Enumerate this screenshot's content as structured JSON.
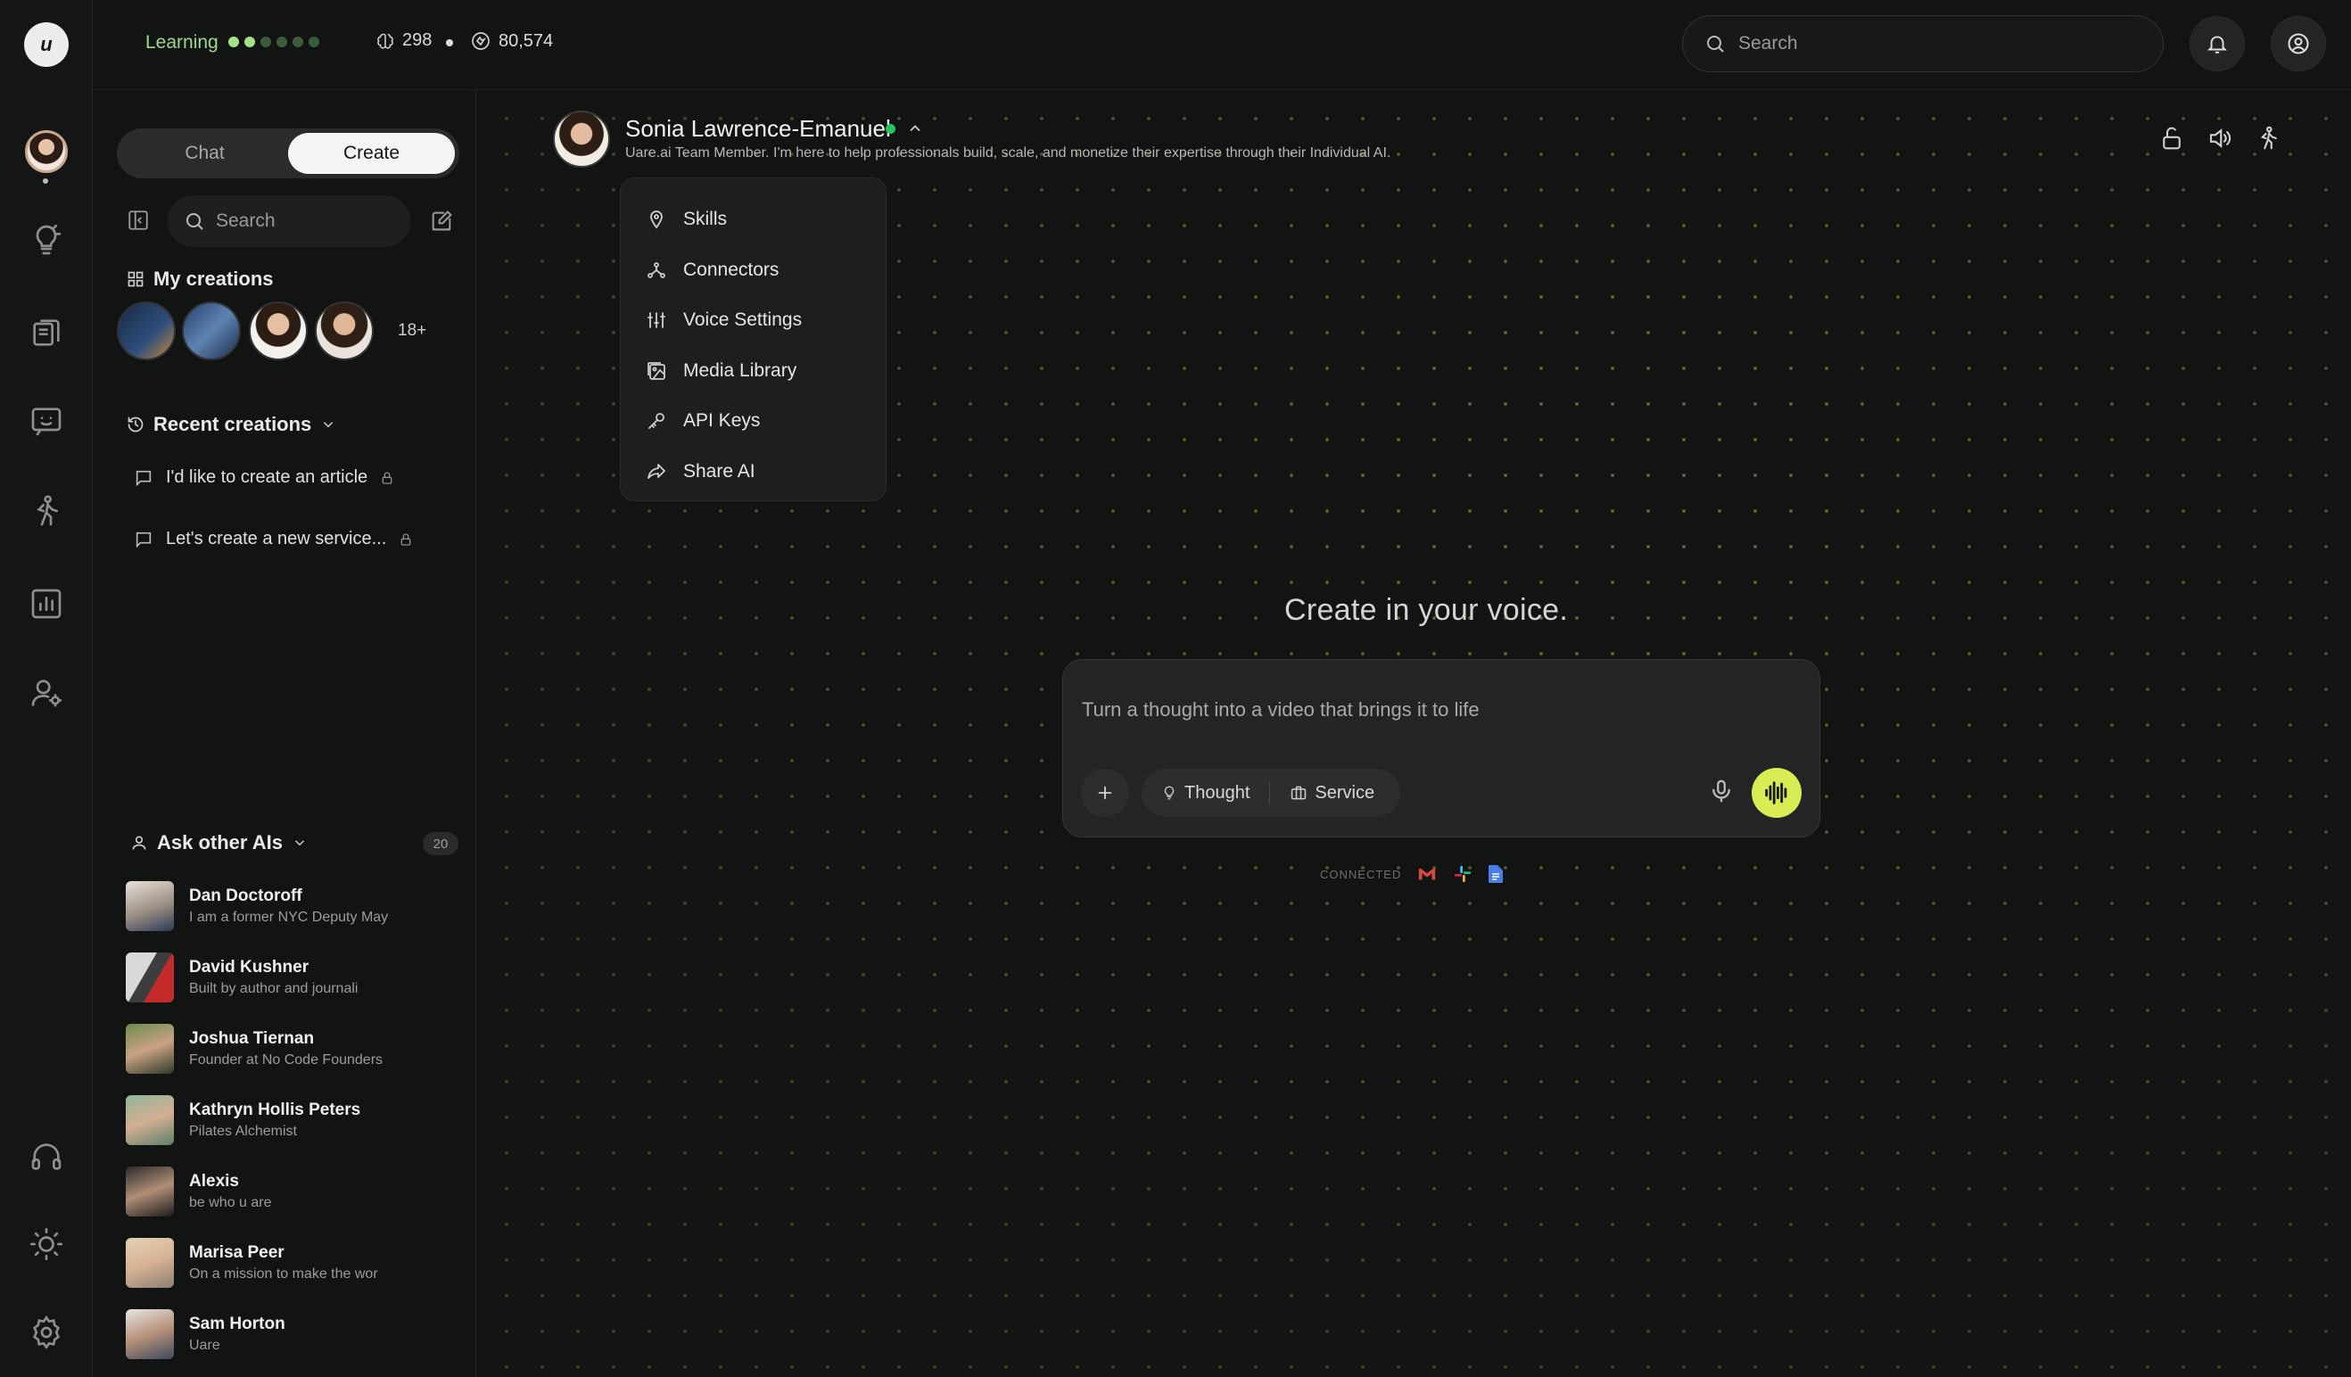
{
  "topbar": {
    "learning_label": "Learning",
    "progress_dots": [
      "#9ed98a",
      "#9ed98a",
      "#3a5a3a",
      "#3a5a3a",
      "#3a5a3a",
      "#3a5a3a"
    ],
    "stat_a": "298",
    "stat_b": "80,574",
    "search_placeholder": "Search"
  },
  "rail": {
    "logo_text": "u",
    "icons": [
      "lightbulb-icon",
      "library-icon",
      "chat-icon",
      "walk-icon",
      "analytics-icon",
      "user-settings-icon",
      "headphones-icon",
      "theme-icon",
      "settings-icon"
    ]
  },
  "panel": {
    "tabs": {
      "chat": "Chat",
      "create": "Create"
    },
    "search_placeholder": "Search",
    "my_creations_title": "My creations",
    "my_creations_more": "18+",
    "recent_title": "Recent creations",
    "recent": [
      {
        "label": "I'd like to create an article"
      },
      {
        "label": "Let's create a new service..."
      }
    ],
    "ask_title": "Ask other AIs",
    "ask_count": "20",
    "ais": [
      {
        "name": "Dan Doctoroff",
        "desc": "I am a former NYC Deputy May"
      },
      {
        "name": "David Kushner",
        "desc": "Built by author and journali"
      },
      {
        "name": "Joshua Tiernan",
        "desc": "Founder at No Code Founders"
      },
      {
        "name": "Kathryn Hollis Peters",
        "desc": "Pilates Alchemist"
      },
      {
        "name": "Alexis",
        "desc": "be who u are"
      },
      {
        "name": "Marisa Peer",
        "desc": "On a mission to make the wor"
      },
      {
        "name": "Sam Horton",
        "desc": "Uare"
      }
    ]
  },
  "agent": {
    "name": "Sonia Lawrence-Emanuel",
    "subtitle": "Uare.ai Team Member. I'm here to help professionals build, scale, and monetize their expertise through their Individual AI.",
    "status_color": "#22c55e"
  },
  "menu": {
    "items": [
      {
        "label": "Skills",
        "icon": "skills-icon"
      },
      {
        "label": "Connectors",
        "icon": "connectors-icon"
      },
      {
        "label": "Voice Settings",
        "icon": "sliders-icon"
      },
      {
        "label": "Media Library",
        "icon": "image-icon"
      },
      {
        "label": "API Keys",
        "icon": "key-icon"
      },
      {
        "label": "Share AI",
        "icon": "share-icon"
      }
    ]
  },
  "composer": {
    "headline": "Create in your voice.",
    "placeholder": "Turn a thought into a video that brings it to life",
    "chip_thought": "Thought",
    "chip_service": "Service",
    "connected_label": "CONNECTED",
    "accent": "#d9ec54"
  }
}
